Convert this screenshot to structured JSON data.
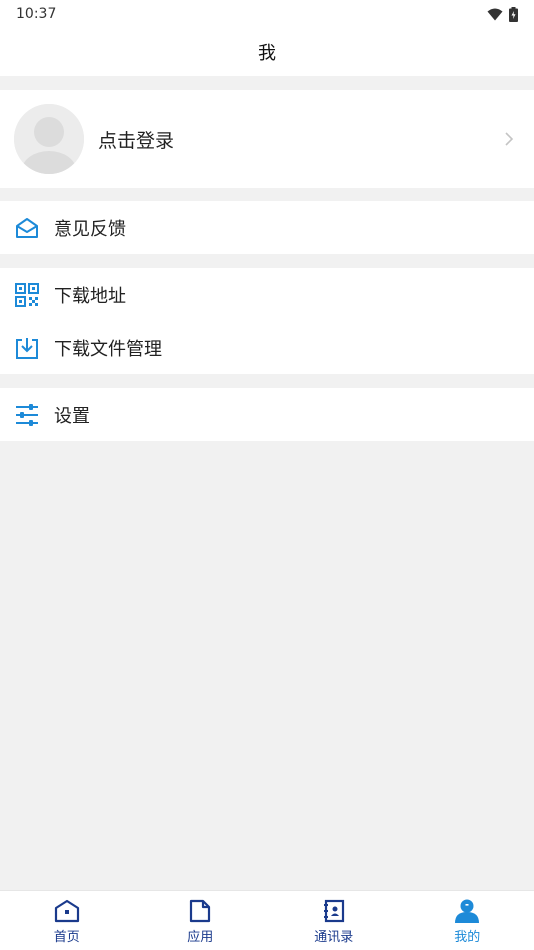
{
  "status_bar": {
    "time": "10:37"
  },
  "header": {
    "title": "我"
  },
  "profile": {
    "login_label": "点击登录"
  },
  "menu": {
    "feedback": "意见反馈",
    "download_address": "下载地址",
    "download_files": "下载文件管理",
    "settings": "设置"
  },
  "tabs": [
    {
      "label": "首页",
      "icon": "home-icon",
      "active": false
    },
    {
      "label": "应用",
      "icon": "document-icon",
      "active": false
    },
    {
      "label": "通讯录",
      "icon": "contacts-icon",
      "active": false
    },
    {
      "label": "我的",
      "icon": "person-icon",
      "active": true
    }
  ],
  "colors": {
    "accent": "#1d8ad8",
    "tab_inactive": "#1a3a8c",
    "background": "#f1f1f1"
  }
}
